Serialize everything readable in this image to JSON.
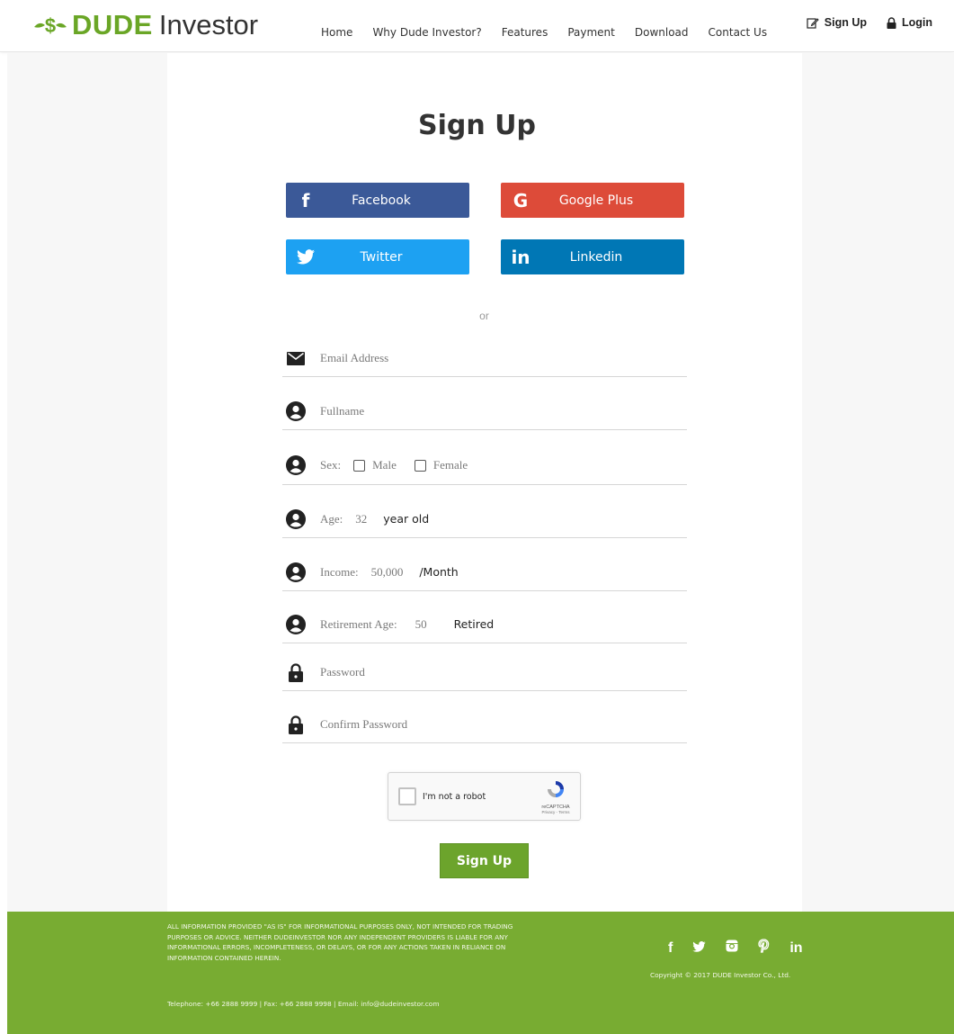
{
  "brand": {
    "strong": "DUDE",
    "light": "Investor",
    "green": "#6aa626"
  },
  "nav": {
    "items": [
      "Home",
      "Why Dude Investor?",
      "Features",
      "Payment",
      "Download",
      "Contact Us"
    ],
    "signup": "Sign Up",
    "login": "Login"
  },
  "form": {
    "title": "Sign Up",
    "social": {
      "facebook": "Facebook",
      "google": "Google Plus",
      "twitter": "Twitter",
      "linkedin": "Linkedin"
    },
    "divider": "or",
    "email_placeholder": "Email Address",
    "fullname_placeholder": "Fullname",
    "sex_label": "Sex:",
    "sex_male": "Male",
    "sex_female": "Female",
    "age_label": "Age:",
    "age_value": "32",
    "age_unit": "year old",
    "income_label": "Income:",
    "income_value": "50,000",
    "income_unit": "/Month",
    "retire_label": "Retirement Age:",
    "retire_value": "50",
    "retire_unit": "Retired",
    "password_placeholder": "Password",
    "confirm_placeholder": "Confirm Password",
    "captcha_label": "I'm not a robot",
    "captcha_brand": "reCAPTCHA",
    "captcha_links": "Privacy - Terms",
    "submit": "Sign Up"
  },
  "footer": {
    "disclaimer": "All information provided \"as is\" for informational purposes only, not intended for trading purposes or advice. Neither DudeInvestor nor any independent providers is liable for any informational errors, incompleteness, or delays, or for any actions taken in reliance on information contained herein.",
    "contact": "Telephone: +66 2888 9999 | Fax: +66 2888 9998 | Email: info@dudeinvestor.com",
    "copyright": "Copyright © 2017 DUDE Investor Co., Ltd.",
    "social_icons": [
      "facebook-icon",
      "twitter-icon",
      "instagram-icon",
      "pinterest-icon",
      "linkedin-icon"
    ]
  },
  "colors": {
    "facebook": "#3b5998",
    "google": "#dd4b39",
    "twitter": "#1da1f2",
    "linkedin": "#0077b5",
    "footer": "#78ac32",
    "button": "#6ca42c"
  }
}
